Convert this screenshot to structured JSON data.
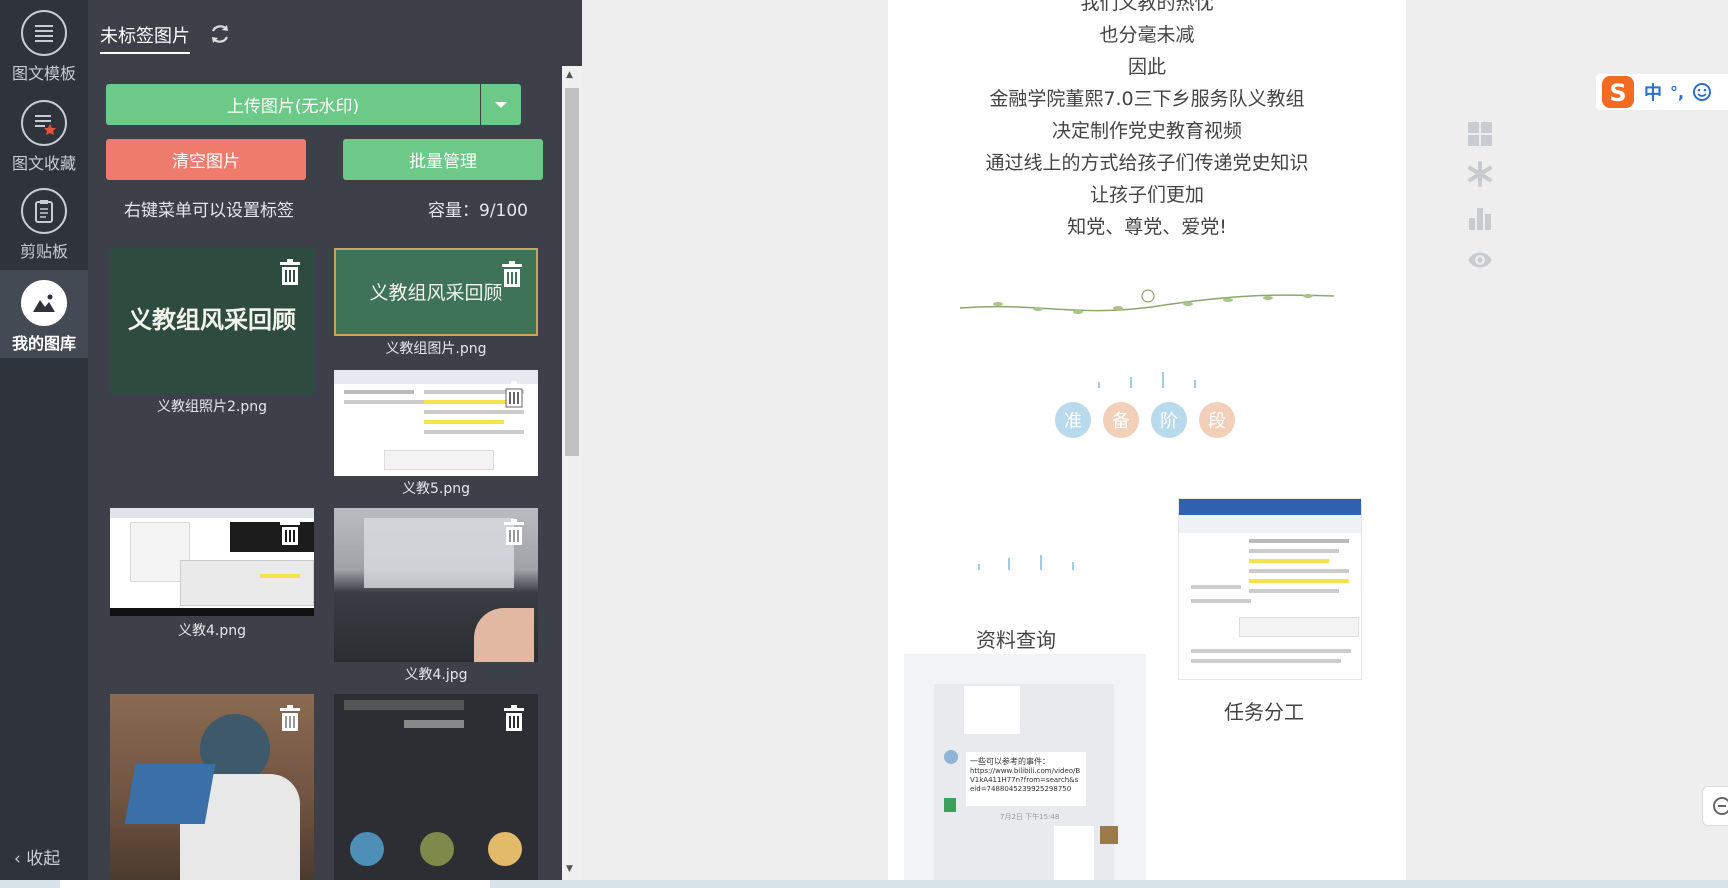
{
  "rail": {
    "items": [
      {
        "label": "图文模板",
        "icon": "list-icon"
      },
      {
        "label": "图文收藏",
        "icon": "favorite-list-icon"
      },
      {
        "label": "剪贴板",
        "icon": "clipboard-icon"
      },
      {
        "label": "我的图库",
        "icon": "image-library-icon"
      }
    ],
    "collapse_label": "收起"
  },
  "panel": {
    "tab_label": "未标签图片",
    "upload_label": "上传图片(无水印)",
    "clear_label": "清空图片",
    "batch_label": "批量管理",
    "hint": "右键菜单可以设置标签",
    "capacity": "容量：9/100",
    "images": [
      {
        "caption": "义教组照片2.png",
        "overlay": "义教组风采回顾"
      },
      {
        "caption": "义教组图片.png",
        "overlay": "义教组风采回顾"
      },
      {
        "caption": "义教5.png"
      },
      {
        "caption": "义教4.png"
      },
      {
        "caption": "义教4.jpg"
      },
      {
        "caption": ""
      },
      {
        "caption": ""
      }
    ]
  },
  "article": {
    "lines": [
      "我们义教的热忱",
      "也分毫未减",
      "因此",
      "金融学院董熙7.0三下乡服务队义教组",
      "决定制作党史教育视频",
      "通过线上的方式给孩子们传递党史知识",
      "让孩子们更加",
      "知党、尊党、爱党!"
    ],
    "stage_chars": [
      "准",
      "备",
      "阶",
      "段"
    ],
    "caption_left": "资料查询",
    "caption_right": "任务分工",
    "chat": {
      "bubble_title": "一些可以参考的事件：",
      "bubble_link": "https://www.bilibili.com/video/BV1kA411H77n?from=search&seid=7488045239925298750",
      "timestamp": "7月2日 下午15:48"
    }
  },
  "ime": {
    "lang": "中",
    "punct": "°,"
  },
  "colors": {
    "rail": "#2f333c",
    "panel": "#3d4049",
    "green": "#6cc987",
    "red": "#ef7b6c",
    "stage_blue": "#b9d9ec",
    "stage_peach": "#f2cfb8"
  }
}
